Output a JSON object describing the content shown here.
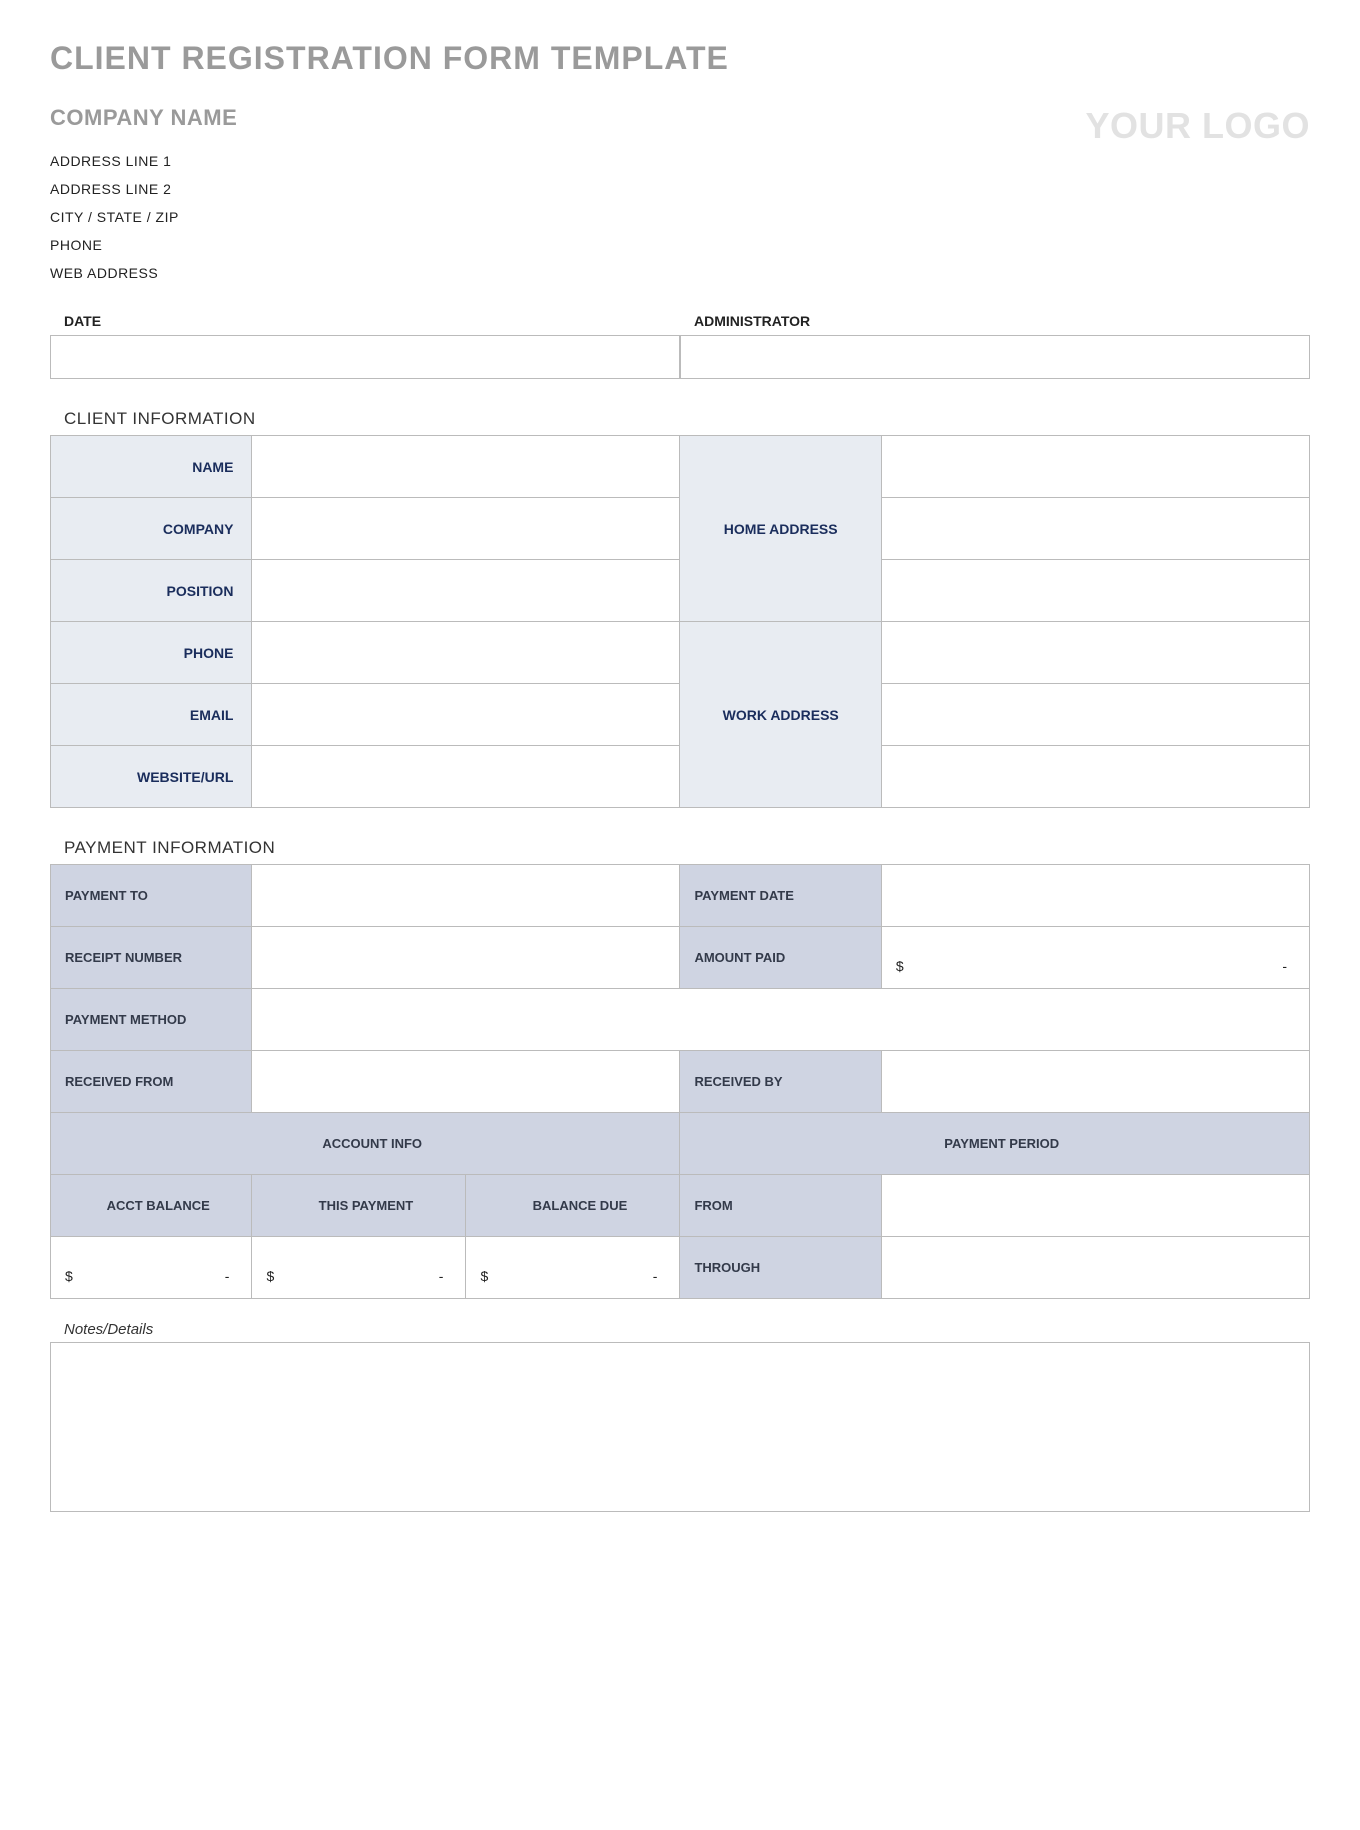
{
  "title": "CLIENT REGISTRATION FORM TEMPLATE",
  "header": {
    "company_heading": "COMPANY NAME",
    "logo_placeholder": "YOUR LOGO",
    "address": {
      "line1": "ADDRESS LINE 1",
      "line2": "ADDRESS LINE 2",
      "city_state_zip": "CITY / STATE / ZIP",
      "phone": "PHONE",
      "web": "WEB ADDRESS"
    }
  },
  "meta": {
    "date_label": "DATE",
    "admin_label": "ADMINISTRATOR"
  },
  "client_section": {
    "title": "CLIENT INFORMATION",
    "labels": {
      "name": "NAME",
      "company": "COMPANY",
      "position": "POSITION",
      "phone": "PHONE",
      "email": "EMAIL",
      "website": "WEBSITE/URL",
      "home_address": "HOME ADDRESS",
      "work_address": "WORK ADDRESS"
    }
  },
  "payment_section": {
    "title": "PAYMENT INFORMATION",
    "labels": {
      "payment_to": "PAYMENT TO",
      "receipt_number": "RECEIPT NUMBER",
      "payment_method": "PAYMENT METHOD",
      "received_from": "RECEIVED FROM",
      "payment_date": "PAYMENT DATE",
      "amount_paid": "AMOUNT PAID",
      "received_by": "RECEIVED BY",
      "account_info": "ACCOUNT INFO",
      "payment_period": "PAYMENT PERIOD",
      "acct_balance": "ACCT BALANCE",
      "this_payment": "THIS PAYMENT",
      "balance_due": "BALANCE DUE",
      "from": "FROM",
      "through": "THROUGH"
    },
    "currency_symbol": "$",
    "empty_dash": "-"
  },
  "notes": {
    "label": "Notes/Details"
  }
}
